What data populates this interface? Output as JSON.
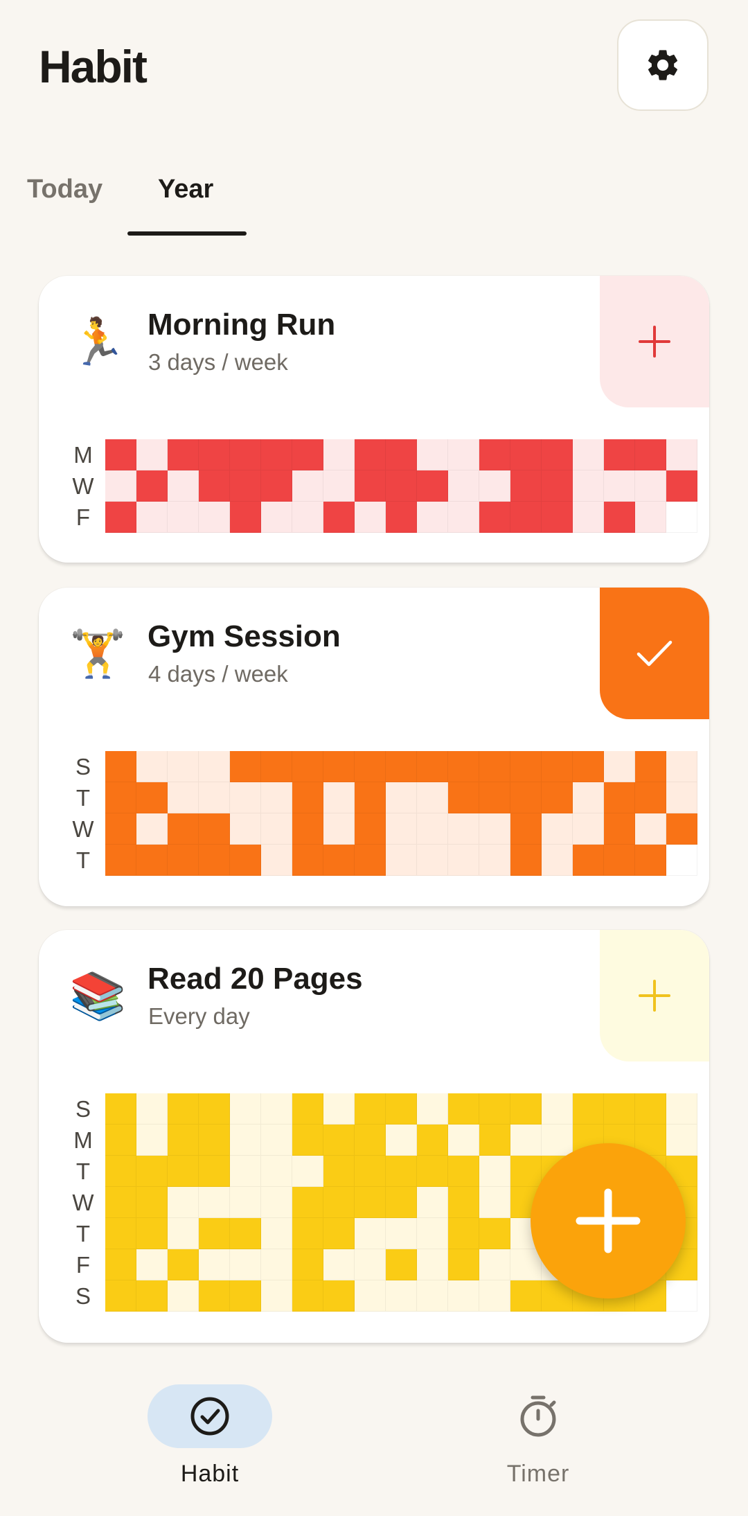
{
  "header": {
    "title": "Habit"
  },
  "tabs": [
    {
      "label": "Today",
      "active": false
    },
    {
      "label": "Year",
      "active": true
    }
  ],
  "habits": [
    {
      "emoji": "🏃",
      "title": "Morning Run",
      "schedule": "3 days / week",
      "action": "add",
      "color": "#ef4444",
      "light_color": "#fde8e8",
      "action_bg": "#fde8e8",
      "action_fg": "#e03a3a",
      "day_labels": [
        "M",
        "W",
        "F"
      ],
      "grid": [
        "1011111011001110110",
        "0101110011100110001",
        "1000100101001110101"
      ]
    },
    {
      "emoji": "🏋️",
      "title": "Gym Session",
      "schedule": "4 days / week",
      "action": "done",
      "color": "#f97316",
      "light_color": "#ffece0",
      "action_bg": "#f97316",
      "action_fg": "#ffffff",
      "day_labels": [
        "S",
        "T",
        "W",
        "T"
      ],
      "grid": [
        "1000111111111111010",
        "1100001010011110110",
        "1011001010000100101",
        "1111101110000101111"
      ]
    },
    {
      "emoji": "📚",
      "title": "Read 20 Pages",
      "schedule": "Every day",
      "action": "add",
      "color": "#facc15",
      "light_color": "#fff8e0",
      "action_bg": "#fefbe0",
      "action_fg": "#f0c21e",
      "day_labels": [
        "S",
        "M",
        "T",
        "W",
        "T",
        "F",
        "S"
      ],
      "grid": [
        "1011001011011101110",
        "1011001110101001110",
        "1111000111110111111",
        "1100001111010101111",
        "1101101100011011111",
        "1010001001010001111",
        "1101101100000111111"
      ]
    }
  ],
  "bottom_nav": [
    {
      "label": "Habit",
      "icon": "check-circle-icon",
      "active": true
    },
    {
      "label": "Timer",
      "icon": "stopwatch-icon",
      "active": false
    }
  ]
}
